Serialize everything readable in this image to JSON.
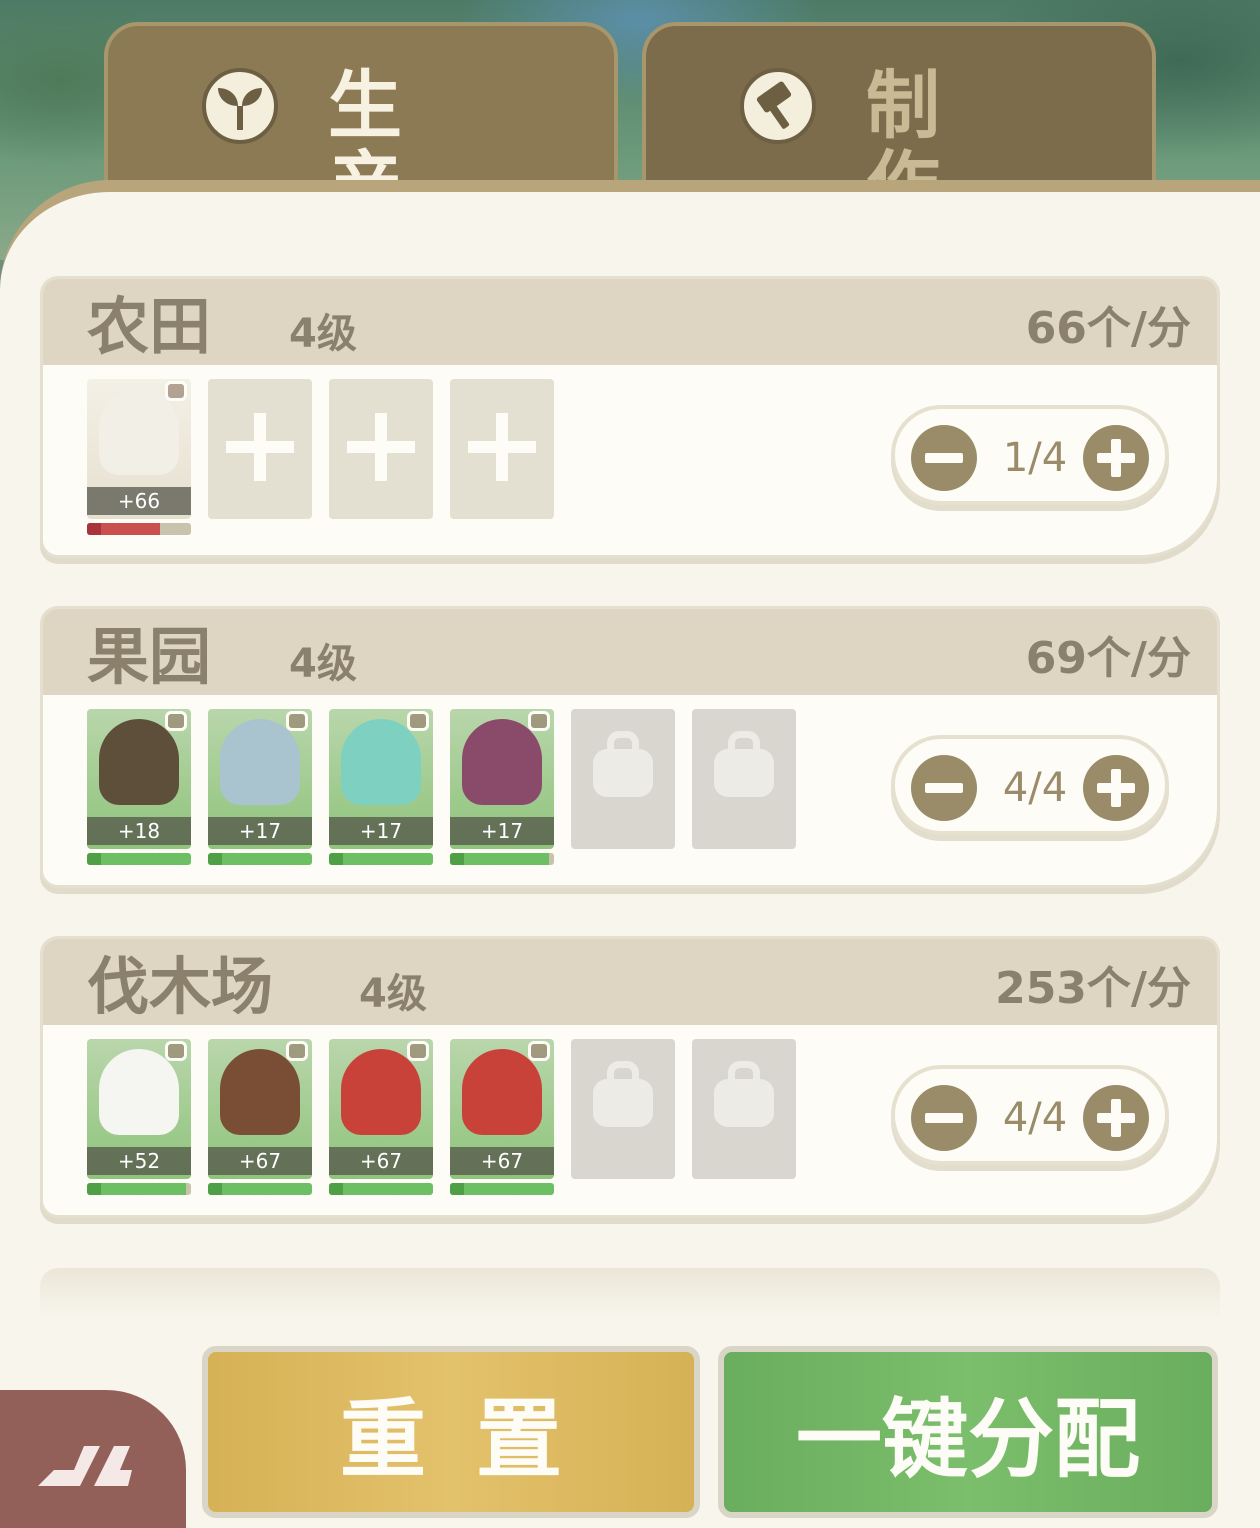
{
  "tabs": [
    {
      "label": "生 产",
      "icon": "sprout-icon",
      "active": true
    },
    {
      "label": "制 作",
      "icon": "hammer-icon",
      "active": false
    }
  ],
  "stations": [
    {
      "name": "农田",
      "level": "4级",
      "rate": "66个/分",
      "count": "1/4",
      "workers": [
        {
          "rate": "+66个/min",
          "progress": 0.7,
          "status": "timer"
        }
      ],
      "empty_slots": 3,
      "locked_slots": 0
    },
    {
      "name": "果园",
      "level": "4级",
      "rate": "69个/分",
      "count": "4/4",
      "workers": [
        {
          "rate": "+18个/min",
          "progress": 1.0,
          "status": "energy"
        },
        {
          "rate": "+17个/min",
          "progress": 1.0,
          "status": "energy"
        },
        {
          "rate": "+17个/min",
          "progress": 1.0,
          "status": "energy"
        },
        {
          "rate": "+17个/min",
          "progress": 0.95,
          "status": "energy"
        }
      ],
      "empty_slots": 0,
      "locked_slots": 2
    },
    {
      "name": "伐木场",
      "level": "4级",
      "rate": "253个/分",
      "count": "4/4",
      "workers": [
        {
          "rate": "+52个/min",
          "progress": 0.95,
          "status": "energy"
        },
        {
          "rate": "+67个/min",
          "progress": 1.0,
          "status": "energy"
        },
        {
          "rate": "+67个/min",
          "progress": 1.0,
          "status": "energy"
        },
        {
          "rate": "+67个/min",
          "progress": 1.0,
          "status": "energy"
        }
      ],
      "empty_slots": 0,
      "locked_slots": 2
    }
  ],
  "buttons": {
    "reset": "重置",
    "auto_assign": "一键分配"
  },
  "colors": {
    "tab": "#8c7a55",
    "panel": "#f7f5ec",
    "reset": "#d6b155",
    "assign": "#69ad5e",
    "corner": "#935f59"
  }
}
